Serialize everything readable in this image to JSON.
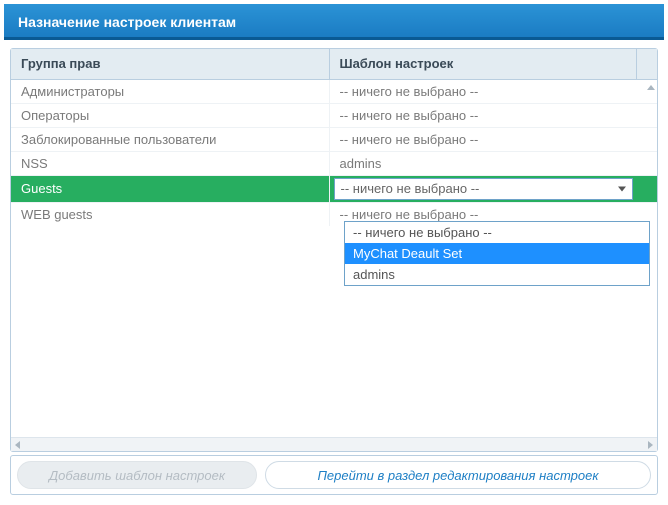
{
  "window": {
    "title": "Назначение настроек клиентам"
  },
  "headers": {
    "group": "Группа прав",
    "template": "Шаблон настроек"
  },
  "rows": [
    {
      "group": "Администраторы",
      "template": "-- ничего не выбрано --",
      "selected": false
    },
    {
      "group": "Операторы",
      "template": "-- ничего не выбрано --",
      "selected": false
    },
    {
      "group": "Заблокированные пользователи",
      "template": "-- ничего не выбрано --",
      "selected": false
    },
    {
      "group": "NSS",
      "template": "admins",
      "selected": false
    },
    {
      "group": "Guests",
      "template": "-- ничего не выбрано --",
      "selected": true,
      "editing": true
    },
    {
      "group": "WEB guests",
      "template": "-- ничего не выбрано --",
      "selected": false
    }
  ],
  "dropdown": {
    "options": [
      {
        "label": "-- ничего не выбрано --",
        "highlight": false
      },
      {
        "label": "MyChat Deault Set",
        "highlight": true
      },
      {
        "label": "admins",
        "highlight": false
      }
    ]
  },
  "footer": {
    "add_template": "Добавить шаблон настроек",
    "goto_edit": "Перейти в раздел редактирования настроек"
  }
}
